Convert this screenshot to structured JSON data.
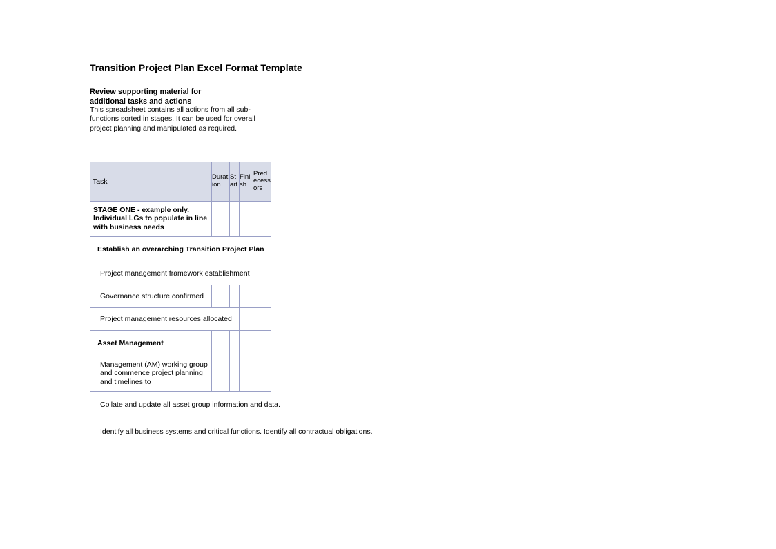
{
  "title": "Transition Project Plan Excel Format Template",
  "subtitle": "Review supporting material for additional tasks and actions",
  "description": "This spreadsheet contains all actions from all sub-functions sorted in stages. It can be used for overall project planning and manipulated as required.",
  "headers": {
    "task": "Task",
    "duration": "Duration",
    "start": "Start",
    "finish": "Finish",
    "predecessors": "Predecessors"
  },
  "rows": {
    "stage": "STAGE ONE - example only. Individual LGs to populate in line with business needs",
    "establish": "Establish an overarching Transition Project Plan",
    "pmf": "Project management framework establishment",
    "gov": "Governance structure confirmed",
    "res": "Project management resources allocated",
    "asset_mgmt": "Asset Management",
    "am_sub": "Management (AM) working group and commence project planning and timelines to",
    "collate": "Collate and update all asset group information and data.",
    "identify": "Identify all business systems and critical functions. Identify all contractual obligations."
  }
}
